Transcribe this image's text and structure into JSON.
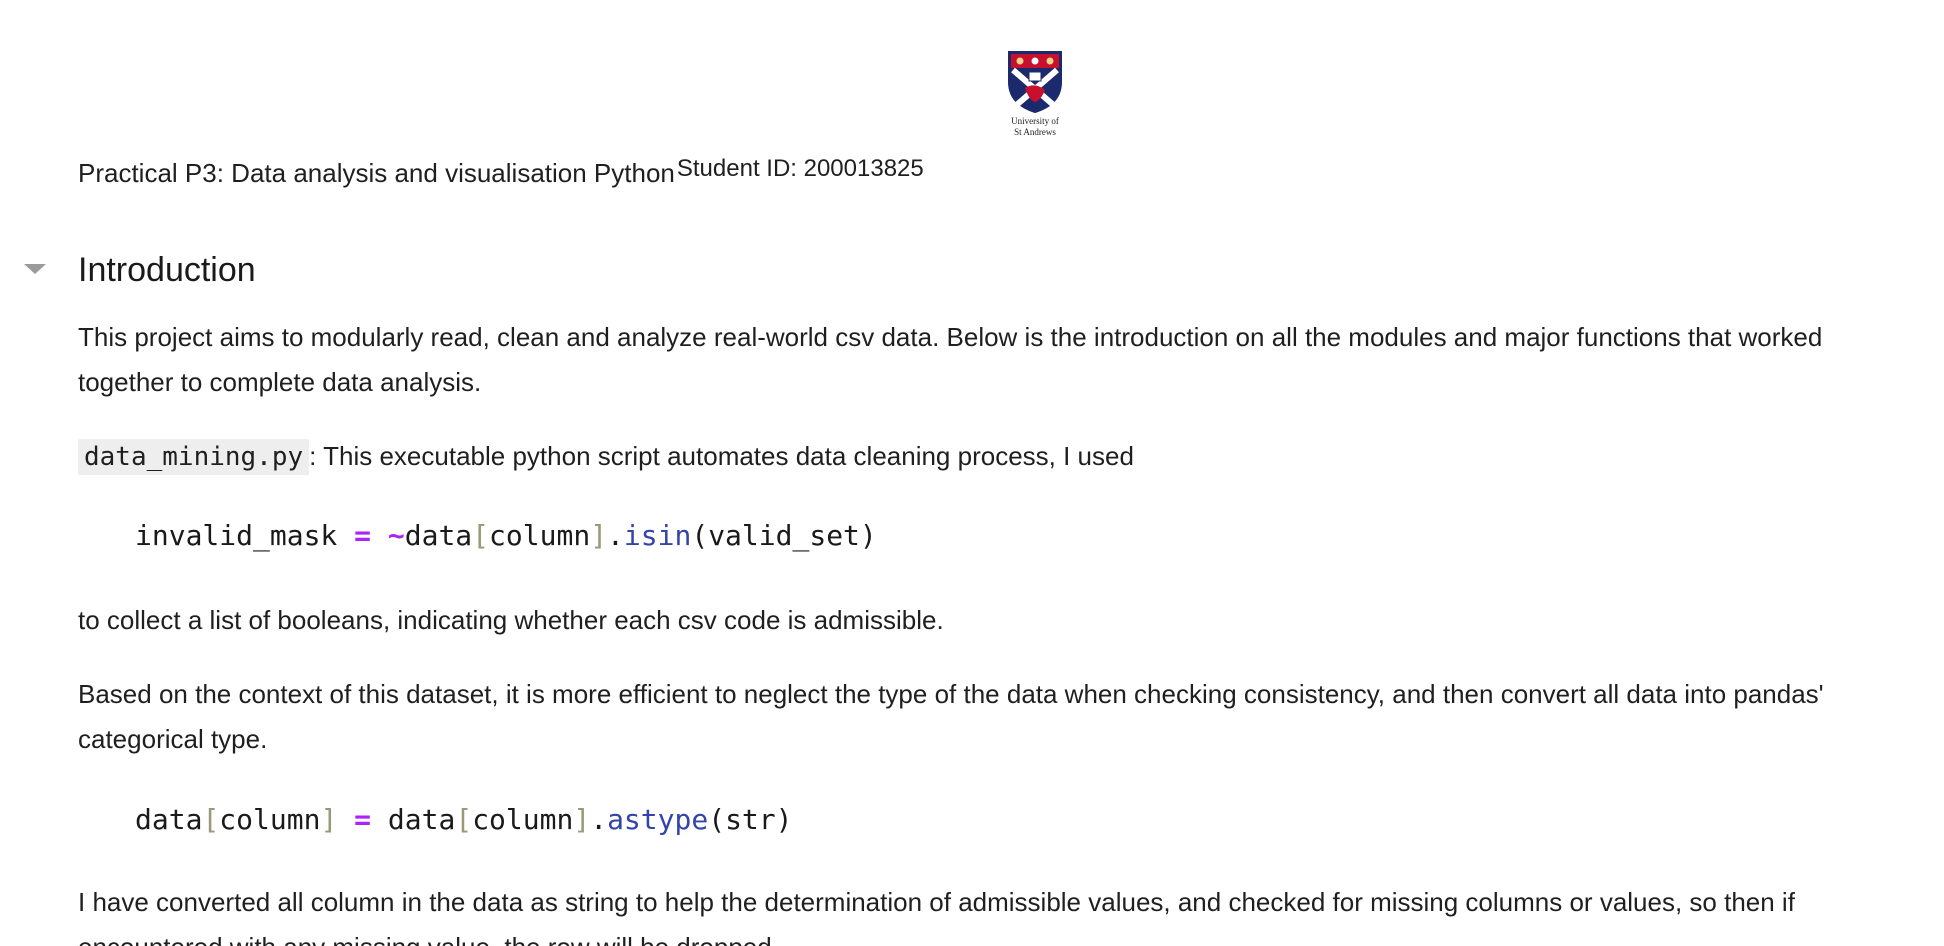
{
  "logo": {
    "line1": "University of",
    "line2": "St Andrews"
  },
  "header": {
    "title": "Practical P3: Data analysis and visualisation Python",
    "student_id": "Student ID: 200013825"
  },
  "section": {
    "heading": "Introduction"
  },
  "paragraphs": {
    "p1": "This project aims to modularly read, clean and analyze real-world csv data. Below is the introduction on all the modules and major functions that worked together to complete data analysis.",
    "p2_code": "data_mining.py",
    "p2_text": ": This executable python script automates data cleaning process, I used",
    "p3": "to collect a list of booleans, indicating whether each csv code is admissible.",
    "p4": "Based on the context of this dataset, it is more efficient to neglect the type of the data when checking consistency, and then convert all data into pandas' categorical type.",
    "p5": "I have converted all column in the data as string to help the determination of admissible values, and checked for missing columns or values, so then if encountered with any missing value, the row will be dropped."
  },
  "code1": {
    "t1": "invalid_mask ",
    "t2": "=",
    "t3": " ",
    "t4": "~",
    "t5": "data",
    "t6": "[",
    "t7": "column",
    "t8": "]",
    "t9": ".",
    "t10": "isin",
    "t11": "(valid_set)"
  },
  "code2": {
    "t1": "data",
    "t2": "[",
    "t3": "column",
    "t4": "]",
    "t5": " ",
    "t6": "=",
    "t7": " data",
    "t8": "[",
    "t9": "column",
    "t10": "]",
    "t11": ".",
    "t12": "astype",
    "t13": "(str)"
  },
  "colors": {
    "operator": "#aa22ff",
    "bracket": "#999977",
    "function": "#3344aa",
    "inline_code_bg": "#eeeeee",
    "caret": "#9a9a9a"
  }
}
